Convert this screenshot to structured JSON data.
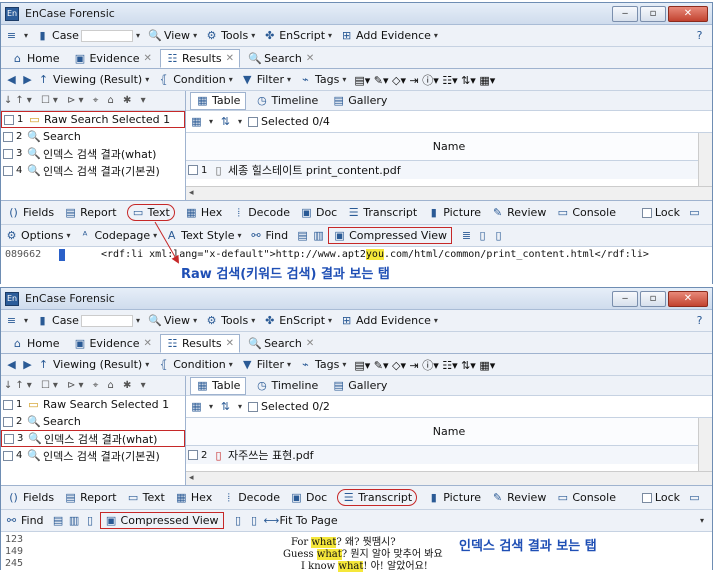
{
  "app_title": "EnCase Forensic",
  "window_buttons": {
    "minimize": "‒",
    "restore": "▫",
    "close": "✕"
  },
  "menubar": {
    "items": [
      "Case",
      "View",
      "Tools",
      "EnScript",
      "Add Evidence"
    ],
    "help_icon": "help-icon"
  },
  "tabs": [
    "Home",
    "Evidence",
    "Results",
    "Search"
  ],
  "navbar": {
    "viewing": "Viewing (Result)",
    "items": [
      "Condition",
      "Filter",
      "Tags"
    ]
  },
  "tree_rows": [
    {
      "n": "1",
      "label": "Raw Search Selected 1"
    },
    {
      "n": "2",
      "label": "Search"
    },
    {
      "n": "3",
      "label": "인덱스 검색 결과(what)"
    },
    {
      "n": "4",
      "label": "인덱스 검색 결과(기본권)"
    }
  ],
  "table_tabs": [
    "Table",
    "Timeline",
    "Gallery"
  ],
  "column_header": "Name",
  "view_tabs": [
    "Fields",
    "Report",
    "Text",
    "Hex",
    "Decode",
    "Doc",
    "Transcript",
    "Picture",
    "Review",
    "Console"
  ],
  "lock_label": "Lock",
  "top": {
    "selected": "Selected 0/4",
    "file_row": {
      "n": "1",
      "name": "세종 힐스테이트 print_content.pdf"
    },
    "subtools": [
      "Options",
      "Codepage",
      "Text Style",
      "Find",
      "Compressed View"
    ],
    "offset": "089662",
    "content_pre": "<rdf:li xml:lang=\"x-default\">http://www.apt2",
    "content_hl": "you",
    "content_post": ".com/html/common/print_content.html</rdf:li>",
    "annotation": "Raw 검색(키워드 검색) 결과 보는 탭"
  },
  "bottom": {
    "selected": "Selected 0/2",
    "file_row": {
      "n": "2",
      "name": "자주쓰는 표현.pdf"
    },
    "subtools": [
      "Find",
      "Compressed View",
      "Fit To Page"
    ],
    "offsets": [
      "123",
      "149",
      "245"
    ],
    "lines": [
      {
        "pre": "For ",
        "hl": "what",
        "post": "? 왜? 뭣땜시?"
      },
      {
        "pre": "Guess ",
        "hl": "what",
        "post": "? 뭔지 알아 맞추어 봐요"
      },
      {
        "pre": "I know ",
        "hl": "what",
        "post": "! 아! 알았어요!"
      }
    ],
    "annotation": "인덱스 검색 결과 보는 탭"
  },
  "colors": {
    "accent": "#1f4fb5",
    "highlight": "#f5e73a",
    "callout": "#c62828"
  }
}
